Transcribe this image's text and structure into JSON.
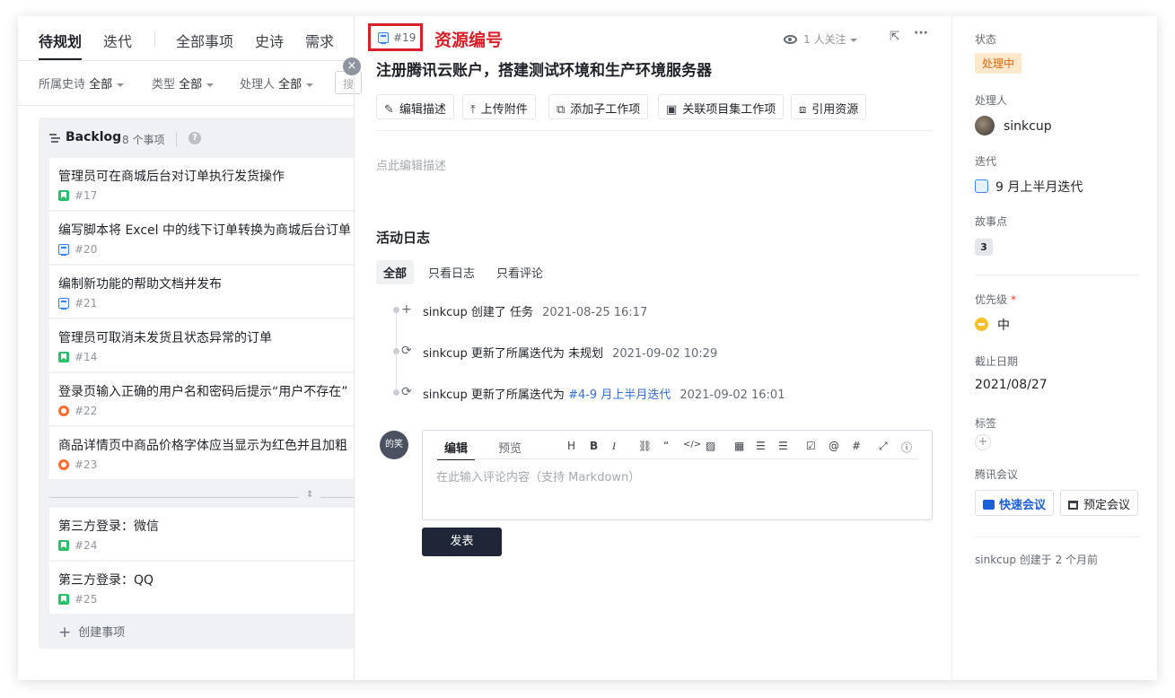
{
  "nav": {
    "tabs": [
      "待规划",
      "迭代",
      "全部事项",
      "史诗",
      "需求"
    ]
  },
  "filters": {
    "epic_label": "所属史诗",
    "epic_value": "全部",
    "type_label": "类型",
    "type_value": "全部",
    "assignee_label": "处理人",
    "assignee_value": "全部",
    "search_placeholder": "搜"
  },
  "backlog": {
    "title": "Backlog",
    "count": "8 个事项",
    "items": [
      {
        "title": "管理员可在商城后台对订单执行发货操作",
        "id": "#17",
        "type": "story"
      },
      {
        "title": "编写脚本将 Excel 中的线下订单转换为商城后台订单",
        "id": "#20",
        "type": "task"
      },
      {
        "title": "编制新功能的帮助文档并发布",
        "id": "#21",
        "type": "task"
      },
      {
        "title": "管理员可取消未发货且状态异常的订单",
        "id": "#14",
        "type": "story"
      },
      {
        "title": "登录页输入正确的用户名和密码后提示“用户不存在”",
        "id": "#22",
        "type": "bug"
      },
      {
        "title": "商品详情页中商品价格字体应当显示为红色并且加粗",
        "id": "#23",
        "type": "bug"
      }
    ],
    "more_items": [
      {
        "title": "第三方登录：微信",
        "id": "#24",
        "type": "story"
      },
      {
        "title": "第三方登录：QQ",
        "id": "#25",
        "type": "story"
      }
    ],
    "create_label": "创建事项"
  },
  "detail": {
    "id": "#19",
    "annotation": "资源编号",
    "watch": "1 人关注",
    "title": "注册腾讯云账户，搭建测试环境和生产环境服务器",
    "toolbar": [
      "编辑描述",
      "上传附件",
      "添加子工作项",
      "关联项目集工作项",
      "引用资源"
    ],
    "description_placeholder": "点此编辑描述",
    "activity_title": "活动日志",
    "activity_tabs": [
      "全部",
      "只看日志",
      "只看评论"
    ],
    "activities": [
      {
        "text": "sinkcup 创建了 任务",
        "link": "",
        "time": "2021-08-25 16:17"
      },
      {
        "text": "sinkcup 更新了所属迭代为  未规划",
        "link": "",
        "time": "2021-09-02 10:29"
      },
      {
        "text": "sinkcup 更新了所属迭代为 ",
        "link": "#4-9 月上半月迭代",
        "time": "2021-09-02 16:01"
      }
    ],
    "comment": {
      "avatar_text": "的笑",
      "tab_edit": "编辑",
      "tab_preview": "预览",
      "placeholder": "在此输入评论内容（支持 Markdown）",
      "submit": "发表"
    }
  },
  "side": {
    "status_label": "状态",
    "status_value": "处理中",
    "assignee_label": "处理人",
    "assignee_value": "sinkcup",
    "iteration_label": "迭代",
    "iteration_value": "9 月上半月迭代",
    "points_label": "故事点",
    "points_value": "3",
    "priority_label": "优先级",
    "priority_required": "*",
    "priority_value": "中",
    "due_label": "截止日期",
    "due_value": "2021/08/27",
    "tags_label": "标签",
    "meeting_label": "腾讯会议",
    "meeting_quick": "快速会议",
    "meeting_schedule": "预定会议",
    "footer": "sinkcup 创建于 2 个月前"
  },
  "colors": {
    "accent": "#1a5fd8",
    "annotation": "#d91f27",
    "status": "#e0660b",
    "button_dark": "#1f2637"
  }
}
